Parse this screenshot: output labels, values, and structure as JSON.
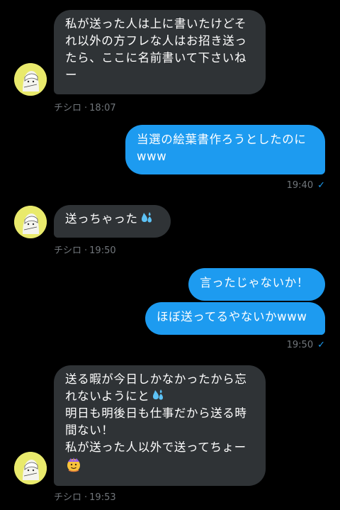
{
  "conversation": {
    "partner_name": "チシロ",
    "messages": [
      {
        "direction": "in",
        "lines": [
          "私が送った人は上に書いたけどそ",
          "れ以外の方フレな人はお招き送っ",
          "たら、ここに名前書いて下さいね",
          "ー"
        ],
        "time": "18:07"
      },
      {
        "direction": "out",
        "lines": [
          "当選の絵葉書作ろうとしたのに",
          "www"
        ],
        "time": "19:40"
      },
      {
        "direction": "in",
        "lines": [
          "送っちゃった"
        ],
        "emoji": "sweat-droplets-icon",
        "time": "19:50"
      },
      {
        "direction": "out",
        "lines": [
          "言ったじゃないか！"
        ]
      },
      {
        "direction": "out",
        "lines": [
          "ほぼ送ってるやないかwww"
        ],
        "time": "19:50"
      },
      {
        "direction": "in",
        "lines": [
          "送る暇が今日しかなかったから忘",
          "れないようにと",
          "明日も明後日も仕事だから送る時",
          "間ない！",
          "私が送った人以外で送ってちょー"
        ],
        "emoji": [
          "sweat-droplets-icon",
          "woozy-face-icon"
        ],
        "time": "19:53"
      }
    ],
    "dot": "·",
    "check": "✓"
  },
  "colors": {
    "background": "#000000",
    "incoming_bubble": "#2f3336",
    "outgoing_bubble": "#1d9bf0",
    "meta_text": "#71767b"
  }
}
